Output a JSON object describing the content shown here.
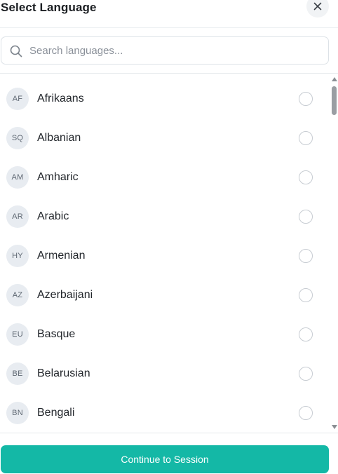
{
  "dialog": {
    "title": "Select Language",
    "close_icon": "close-icon"
  },
  "search": {
    "placeholder": "Search languages...",
    "value": "",
    "icon": "search-icon"
  },
  "languages": [
    {
      "code": "AF",
      "name": "Afrikaans",
      "selected": false
    },
    {
      "code": "SQ",
      "name": "Albanian",
      "selected": false
    },
    {
      "code": "AM",
      "name": "Amharic",
      "selected": false
    },
    {
      "code": "AR",
      "name": "Arabic",
      "selected": false
    },
    {
      "code": "HY",
      "name": "Armenian",
      "selected": false
    },
    {
      "code": "AZ",
      "name": "Azerbaijani",
      "selected": false
    },
    {
      "code": "EU",
      "name": "Basque",
      "selected": false
    },
    {
      "code": "BE",
      "name": "Belarusian",
      "selected": false
    },
    {
      "code": "BN",
      "name": "Bengali",
      "selected": false
    }
  ],
  "footer": {
    "continue_label": "Continue to Session"
  },
  "colors": {
    "accent": "#14b8a6",
    "badge_bg": "#e8ecf1",
    "radio_border": "#c7ccd2"
  }
}
